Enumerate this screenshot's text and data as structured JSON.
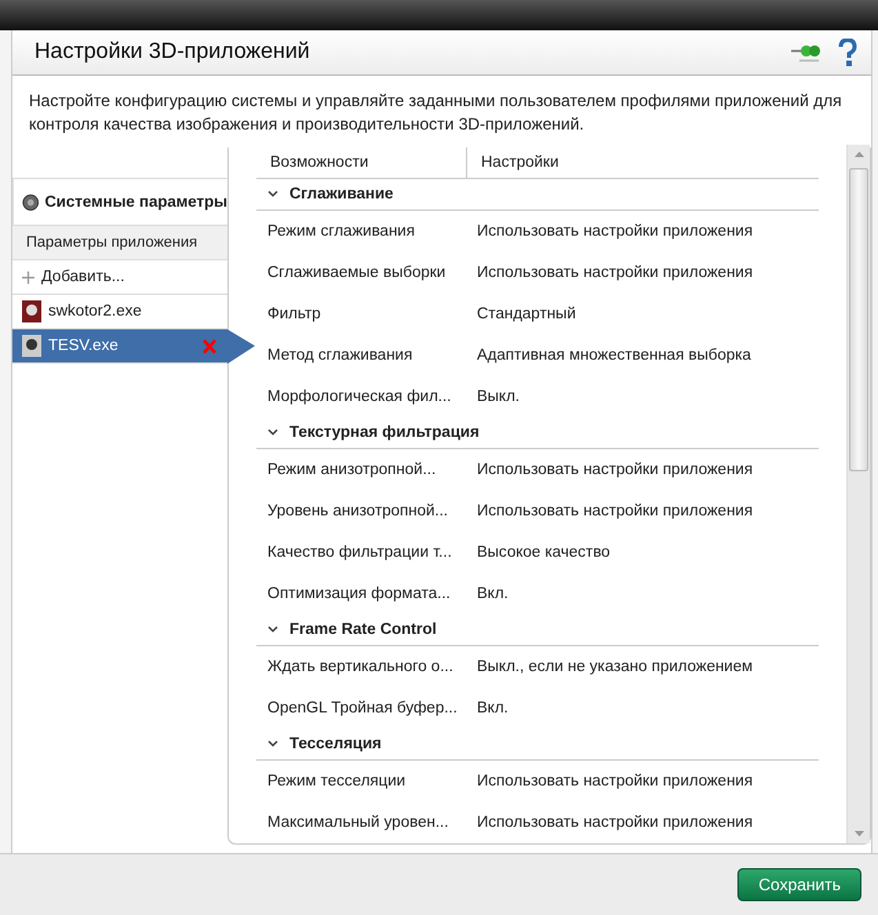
{
  "window": {
    "title": "Настройки 3D-приложений"
  },
  "description": "Настройте конфигурацию системы и управляйте заданными пользователем профилями приложений для контроля качества изображения и производительности 3D-приложений.",
  "sidebar": {
    "system": "Системные параметры",
    "section": "Параметры приложения",
    "add": "Добавить...",
    "items": [
      {
        "label": "swkotor2.exe",
        "selected": false
      },
      {
        "label": "TESV.exe",
        "selected": true
      }
    ]
  },
  "table": {
    "columns": [
      "Возможности",
      "Настройки"
    ],
    "groups": [
      {
        "title": "Сглаживание",
        "expanded": true,
        "rows": [
          [
            "Режим сглаживания",
            "Использовать настройки приложения"
          ],
          [
            "Сглаживаемые выборки",
            "Использовать настройки приложения"
          ],
          [
            "Фильтр",
            "Стандартный"
          ],
          [
            "Метод сглаживания",
            "Адаптивная множественная выборка"
          ],
          [
            "Морфологическая фил...",
            "Выкл."
          ]
        ]
      },
      {
        "title": "Текстурная фильтрация",
        "expanded": true,
        "rows": [
          [
            "Режим анизотропной...",
            "Использовать настройки приложения"
          ],
          [
            "Уровень анизотропной...",
            "Использовать настройки приложения"
          ],
          [
            "Качество фильтрации т...",
            "Высокое качество"
          ],
          [
            "Оптимизация формата...",
            "Вкл."
          ]
        ]
      },
      {
        "title": "Frame Rate Control",
        "expanded": true,
        "rows": [
          [
            "Ждать вертикального о...",
            "Выкл., если не указано приложением"
          ],
          [
            "OpenGL Тройная буфер...",
            "Вкл."
          ]
        ]
      },
      {
        "title": "Тесселяция",
        "expanded": true,
        "rows": [
          [
            "Режим тесселяции",
            "Использовать настройки приложения"
          ],
          [
            "Максимальный уровен...",
            "Использовать настройки приложения"
          ]
        ]
      }
    ]
  },
  "buttons": {
    "save": "Сохранить"
  }
}
